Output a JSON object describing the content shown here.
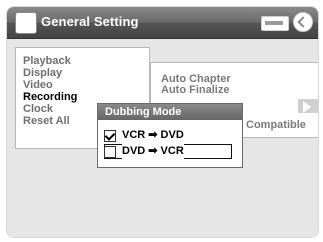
{
  "window": {
    "title": "General Setting",
    "icons": {
      "title": "wrench-icon",
      "disc": "disc-icon",
      "return": "return-icon"
    }
  },
  "sidebar": {
    "items": [
      {
        "label": "Playback"
      },
      {
        "label": "Display"
      },
      {
        "label": "Video"
      },
      {
        "label": "Recording",
        "selected": true
      },
      {
        "label": "Clock"
      },
      {
        "label": "Reset All"
      }
    ]
  },
  "subpanel": {
    "items": [
      {
        "label": "Auto Chapter"
      },
      {
        "label": "Auto Finalize"
      },
      {
        "label": "Compatible"
      }
    ]
  },
  "popup": {
    "title": "Dubbing Mode",
    "options": [
      {
        "label": "VCR ➡ DVD",
        "checked": true
      },
      {
        "label": "DVD ➡ VCR",
        "checked": false,
        "focused": true
      }
    ]
  }
}
